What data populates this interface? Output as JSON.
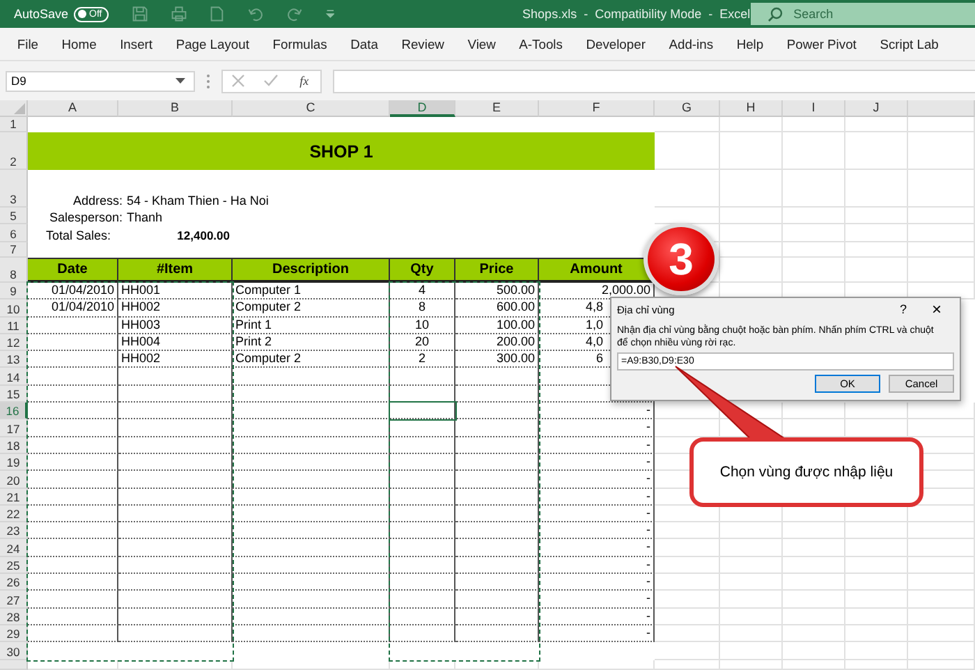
{
  "title_bar": {
    "autosave_label": "AutoSave",
    "autosave": {
      "on": false,
      "label": "Off"
    },
    "title": "Shops.xls  -  Compatibility Mode  -  Excel",
    "search": {
      "placeholder": "Search"
    }
  },
  "ribbon_tabs": [
    "File",
    "Home",
    "Insert",
    "Page Layout",
    "Formulas",
    "Data",
    "Review",
    "View",
    "A-Tools",
    "Developer",
    "Add-ins",
    "Help",
    "Power Pivot",
    "Script Lab"
  ],
  "formula_bar": {
    "name_box": "D9",
    "function_label": "fx"
  },
  "columns": [
    {
      "label": "A",
      "selected": false
    },
    {
      "label": "B",
      "selected": false
    },
    {
      "label": "C",
      "selected": false
    },
    {
      "label": "D",
      "selected": true
    },
    {
      "label": "E",
      "selected": false
    },
    {
      "label": "F",
      "selected": false
    },
    {
      "label": "G",
      "selected": false
    },
    {
      "label": "H",
      "selected": false
    },
    {
      "label": "I",
      "selected": false
    },
    {
      "label": "J",
      "selected": false
    }
  ],
  "row_headers": [
    {
      "label": "1",
      "selected": false
    },
    {
      "label": "2",
      "selected": false
    },
    {
      "label": "3",
      "selected": false
    },
    {
      "label": "5",
      "selected": false
    },
    {
      "label": "6",
      "selected": false
    },
    {
      "label": "7",
      "selected": false
    },
    {
      "label": "8",
      "selected": false
    },
    {
      "label": "9",
      "selected": false
    },
    {
      "label": "10",
      "selected": false
    },
    {
      "label": "11",
      "selected": false
    },
    {
      "label": "12",
      "selected": false
    },
    {
      "label": "13",
      "selected": false
    },
    {
      "label": "14",
      "selected": false
    },
    {
      "label": "15",
      "selected": false
    },
    {
      "label": "16",
      "selected": true
    },
    {
      "label": "17",
      "selected": false
    },
    {
      "label": "18",
      "selected": false
    },
    {
      "label": "19",
      "selected": false
    },
    {
      "label": "20",
      "selected": false
    },
    {
      "label": "21",
      "selected": false
    },
    {
      "label": "22",
      "selected": false
    },
    {
      "label": "23",
      "selected": false
    },
    {
      "label": "24",
      "selected": false
    },
    {
      "label": "25",
      "selected": false
    },
    {
      "label": "26",
      "selected": false
    },
    {
      "label": "27",
      "selected": false
    },
    {
      "label": "28",
      "selected": false
    },
    {
      "label": "29",
      "selected": false
    },
    {
      "label": "30",
      "selected": false
    }
  ],
  "sheet": {
    "title": "SHOP 1",
    "address_label": "Address:",
    "address": "54 - Kham Thien - Ha Noi",
    "salesperson_label": "Salesperson:",
    "salesperson": "Thanh",
    "total_label": "Total Sales:",
    "total": "12,400.00",
    "headers": [
      "Date",
      "#Item",
      "Description",
      "Qty",
      "Price",
      "Amount"
    ],
    "rows": [
      {
        "date": "01/04/2010",
        "item": "HH001",
        "description": "Computer 1",
        "qty": "4",
        "price": "500.00",
        "amount": "2,000.00"
      },
      {
        "date": "01/04/2010",
        "item": "HH002",
        "description": "Computer 2",
        "qty": "8",
        "price": "600.00",
        "amount": "4,8"
      },
      {
        "item": "HH003",
        "description": "Print 1",
        "qty": "10",
        "price": "100.00",
        "amount": "1,0"
      },
      {
        "item": "HH004",
        "description": "Print 2",
        "qty": "20",
        "price": "200.00",
        "amount": "4,0"
      },
      {
        "item": "HH002",
        "description": "Computer 2",
        "qty": "2",
        "price": "300.00",
        "amount": "6"
      },
      {},
      {},
      {
        "amount": "-"
      },
      {
        "amount": "-"
      },
      {
        "amount": "-"
      },
      {
        "amount": "-"
      },
      {
        "amount": "-"
      },
      {
        "amount": "-"
      },
      {
        "amount": "-"
      },
      {
        "amount": "-"
      },
      {
        "amount": "-"
      },
      {
        "amount": "-"
      },
      {
        "amount": "-"
      },
      {
        "amount": "-"
      },
      {
        "amount": "-"
      },
      {
        "amount": "-"
      }
    ]
  },
  "dialog": {
    "title": "Địa chỉ vùng",
    "help": "?",
    "close": "×",
    "message": "Nhận địa chỉ vùng bằng chuột hoặc bàn phím. Nhấn phím CTRL và chuột để chọn nhiều vùng rời rạc.",
    "value": "=A9:B30,D9:E30",
    "buttons": [
      {
        "label": "OK",
        "default": true
      },
      {
        "label": "Cancel",
        "default": false
      }
    ]
  },
  "step_badge": "3",
  "callout": "Chọn vùng được nhập liệu"
}
